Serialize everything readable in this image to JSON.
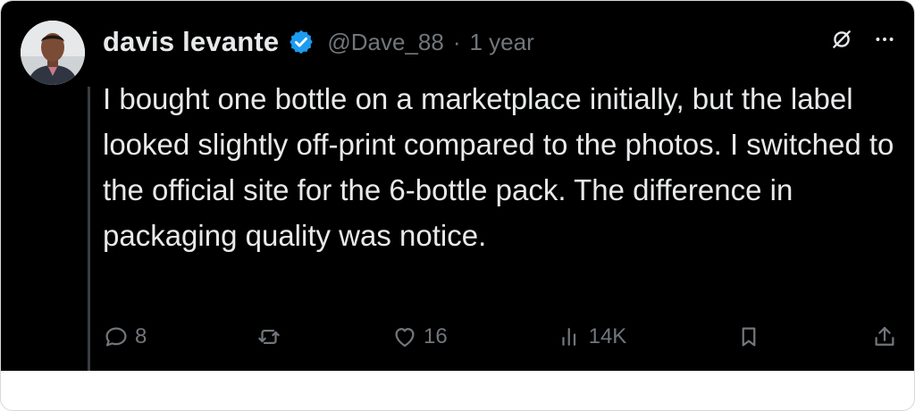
{
  "post": {
    "author_name": "davis levante",
    "handle": "@Dave_88",
    "separator": "·",
    "time": "1 year",
    "text": "I bought one bottle on a marketplace initially, but the label looked slightly off-print compared to the photos. I switched to the official site for the 6-bottle pack. The difference in packaging quality was notice."
  },
  "actions": {
    "reply_count": "8",
    "like_count": "16",
    "view_count": "14K"
  },
  "colors": {
    "background": "#000000",
    "text": "#e7e9ea",
    "muted": "#71767b",
    "verified": "#1d9bf0"
  },
  "icons": [
    "grok-icon",
    "more-icon",
    "verified-badge-icon",
    "reply-icon",
    "repost-icon",
    "like-icon",
    "views-icon",
    "bookmark-icon",
    "share-icon"
  ]
}
